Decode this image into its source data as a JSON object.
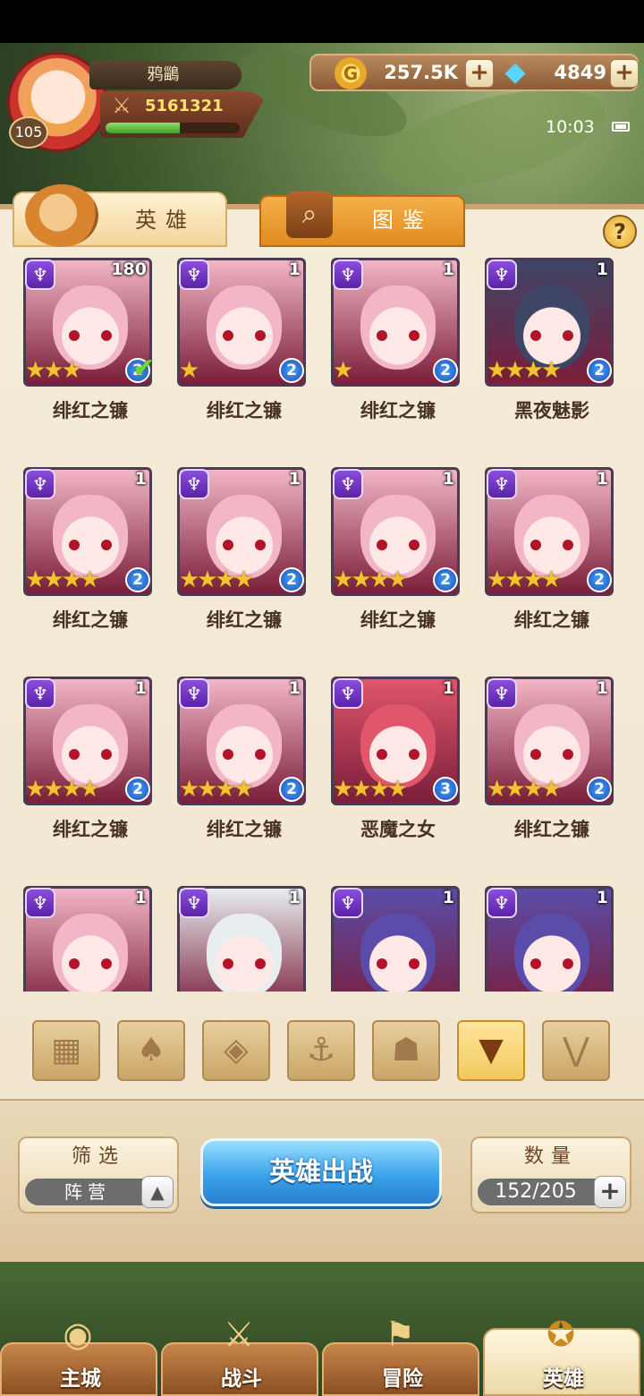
{
  "player": {
    "name": "鸦鶅",
    "level": "105",
    "power": "5161321",
    "exp_fraction": 0.55
  },
  "currency": {
    "gold": "257.5K",
    "gems": "4849"
  },
  "status": {
    "time": "10:03"
  },
  "tabs": [
    {
      "label": "英雄",
      "active": true
    },
    {
      "label": "图鉴",
      "active": false
    }
  ],
  "help_label": "?",
  "heroes": [
    {
      "name": "绯红之镰",
      "level": "180",
      "stars": 3,
      "rank": "2",
      "checked": true,
      "skin": "#f2b6c6"
    },
    {
      "name": "绯红之镰",
      "level": "1",
      "stars": 1,
      "rank": "2",
      "checked": false,
      "skin": "#f2b6c6"
    },
    {
      "name": "绯红之镰",
      "level": "1",
      "stars": 1,
      "rank": "2",
      "checked": false,
      "skin": "#f2b6c6"
    },
    {
      "name": "黑夜魅影",
      "level": "1",
      "stars": 4,
      "rank": "2",
      "checked": false,
      "skin": "#3f4566"
    },
    {
      "name": "绯红之镰",
      "level": "1",
      "stars": 4,
      "rank": "2",
      "checked": false,
      "skin": "#f2b6c6"
    },
    {
      "name": "绯红之镰",
      "level": "1",
      "stars": 4,
      "rank": "2",
      "checked": false,
      "skin": "#f2b6c6"
    },
    {
      "name": "绯红之镰",
      "level": "1",
      "stars": 4,
      "rank": "2",
      "checked": false,
      "skin": "#f2b6c6"
    },
    {
      "name": "绯红之镰",
      "level": "1",
      "stars": 4,
      "rank": "2",
      "checked": false,
      "skin": "#f2b6c6"
    },
    {
      "name": "绯红之镰",
      "level": "1",
      "stars": 4,
      "rank": "2",
      "checked": false,
      "skin": "#f2b6c6"
    },
    {
      "name": "绯红之镰",
      "level": "1",
      "stars": 4,
      "rank": "2",
      "checked": false,
      "skin": "#f2b6c6"
    },
    {
      "name": "恶魔之女",
      "level": "1",
      "stars": 4,
      "rank": "3",
      "checked": false,
      "skin": "#e0566a"
    },
    {
      "name": "绯红之镰",
      "level": "1",
      "stars": 4,
      "rank": "2",
      "checked": false,
      "skin": "#f2b6c6"
    },
    {
      "name": "",
      "level": "1",
      "stars": 0,
      "rank": "",
      "checked": false,
      "skin": "#f2b6c6"
    },
    {
      "name": "",
      "level": "1",
      "stars": 0,
      "rank": "",
      "checked": false,
      "skin": "#e8eef0"
    },
    {
      "name": "",
      "level": "1",
      "stars": 0,
      "rank": "",
      "checked": false,
      "skin": "#5a4ca8"
    },
    {
      "name": "",
      "level": "1",
      "stars": 0,
      "rank": "",
      "checked": false,
      "skin": "#5a4ca8"
    }
  ],
  "filters": [
    {
      "icon": "grid-icon",
      "glyph": "▦",
      "active": false
    },
    {
      "icon": "leaf-faction-icon",
      "glyph": "♠",
      "active": false
    },
    {
      "icon": "diamond-faction-icon",
      "glyph": "◈",
      "active": false
    },
    {
      "icon": "anchor-faction-icon",
      "glyph": "⚓",
      "active": false
    },
    {
      "icon": "beast-faction-icon",
      "glyph": "☗",
      "active": false
    },
    {
      "icon": "demon-faction-icon",
      "glyph": "▼",
      "active": true
    },
    {
      "icon": "wings-faction-icon",
      "glyph": "⋁",
      "active": false
    }
  ],
  "filter": {
    "title": "筛选",
    "value": "阵营"
  },
  "deploy_label": "英雄出战",
  "count": {
    "title": "数量",
    "value": "152/205"
  },
  "nav": [
    {
      "label": "主城",
      "icon": "castle-icon",
      "glyph": "◉",
      "active": false
    },
    {
      "label": "战斗",
      "icon": "crossed-swords-icon",
      "glyph": "⚔",
      "active": false
    },
    {
      "label": "冒险",
      "icon": "scroll-map-icon",
      "glyph": "⚑",
      "active": false
    },
    {
      "label": "英雄",
      "icon": "hero-emblem-icon",
      "glyph": "✪",
      "active": true
    }
  ]
}
